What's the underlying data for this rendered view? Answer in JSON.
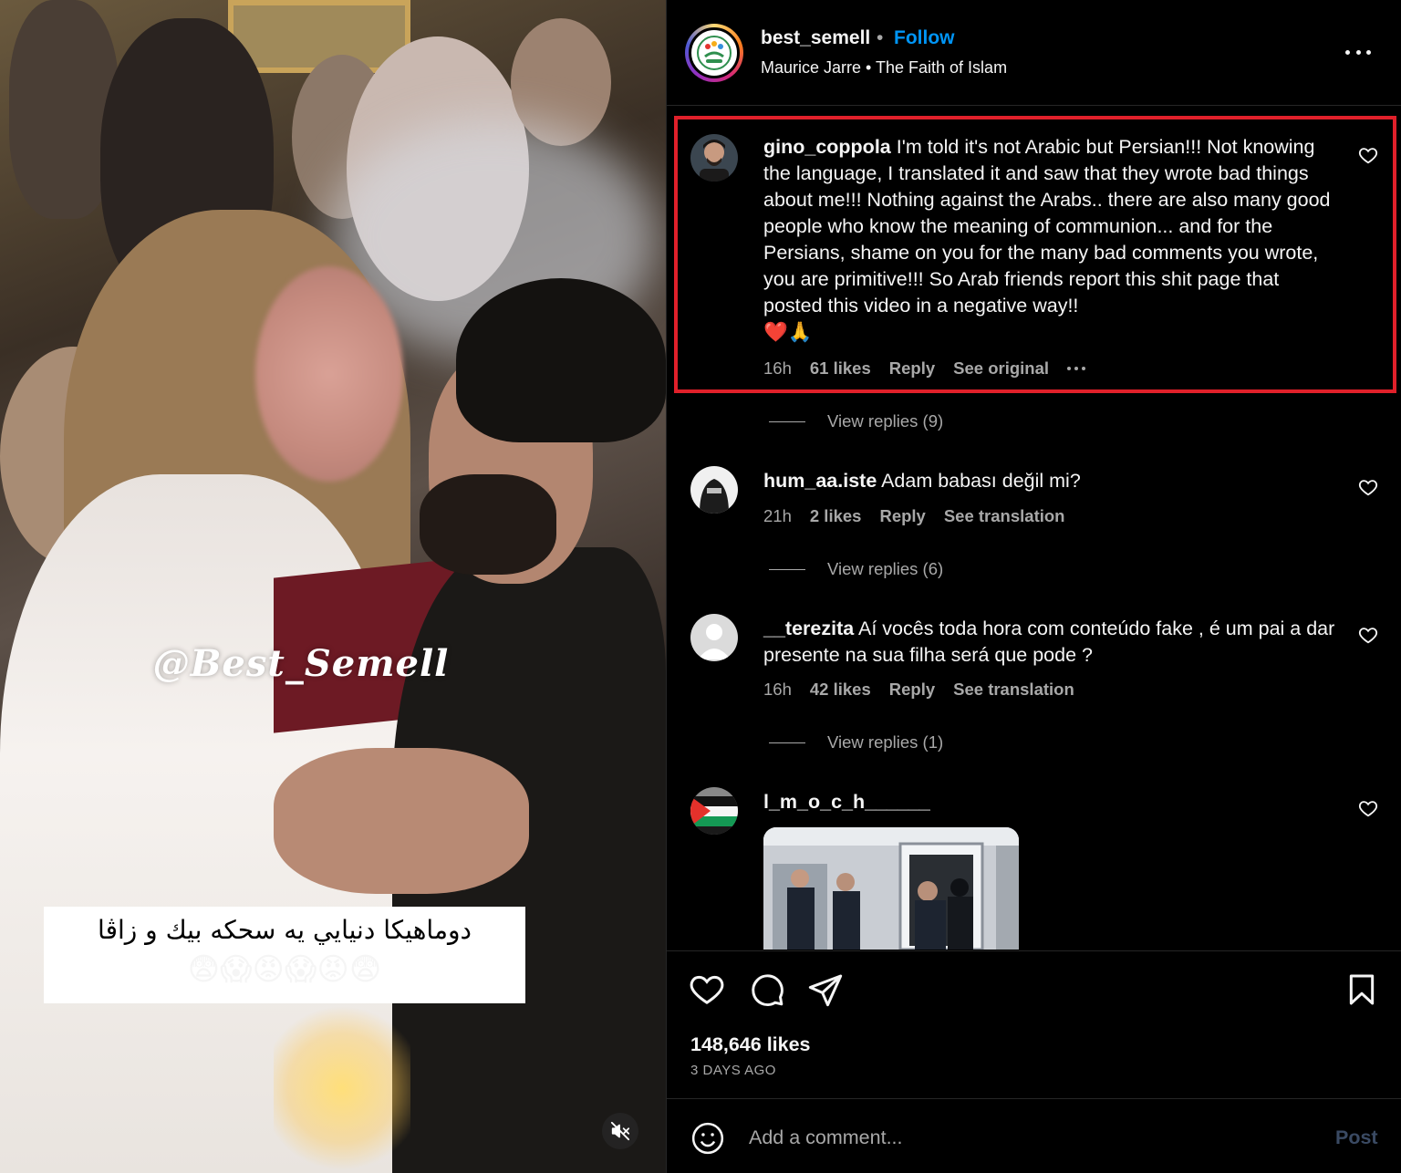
{
  "media": {
    "watermark": "@Best_Semell",
    "caption_text": "دوماهيكا دنيايي يه سحكه بيك و زاڤا",
    "caption_emoji": "😨😱😡😱😡😨",
    "mute_icon": "volume-off-icon"
  },
  "header": {
    "username": "best_semell",
    "separator": "•",
    "follow_label": "Follow",
    "audio": "Maurice Jarre • The Faith of Islam",
    "more_icon": "more-horizontal-icon"
  },
  "comments": [
    {
      "username": "gino_coppola",
      "text": "I'm told it's not Arabic but Persian!!! Not knowing the language, I translated it and saw that they wrote bad things about me!!! Nothing against the Arabs.. there are also many good people who know the meaning of communion... and for the Persians, shame on you for the many bad comments you wrote, you are primitive!!! So Arab friends report this shit page that posted this video in a negative way!!",
      "emoji": "❤️🙏",
      "time": "16h",
      "likes": "61 likes",
      "reply_label": "Reply",
      "extra_label": "See original",
      "view_replies": "View replies (9)"
    },
    {
      "username": "hum_aa.iste",
      "text": "Adam babası değil mi?",
      "time": "21h",
      "likes": "2 likes",
      "reply_label": "Reply",
      "extra_label": "See translation",
      "view_replies": "View replies (6)"
    },
    {
      "username": "__terezita",
      "text": "Aí vocês toda hora com conteúdo fake , é um pai a dar presente na sua filha será que pode ?",
      "time": "16h",
      "likes": "42 likes",
      "reply_label": "Reply",
      "extra_label": "See translation",
      "view_replies": "View replies (1)"
    },
    {
      "username": "l_m_o_c_h______"
    }
  ],
  "actions": {
    "likes_count": "148,646 likes",
    "posted": "3 DAYS AGO"
  },
  "add_comment": {
    "placeholder": "Add a comment...",
    "post_label": "Post"
  },
  "colors": {
    "accent": "#0095f6",
    "highlight_border": "#e0202a",
    "secondary_text": "#a8a8a8",
    "background": "#000000"
  }
}
